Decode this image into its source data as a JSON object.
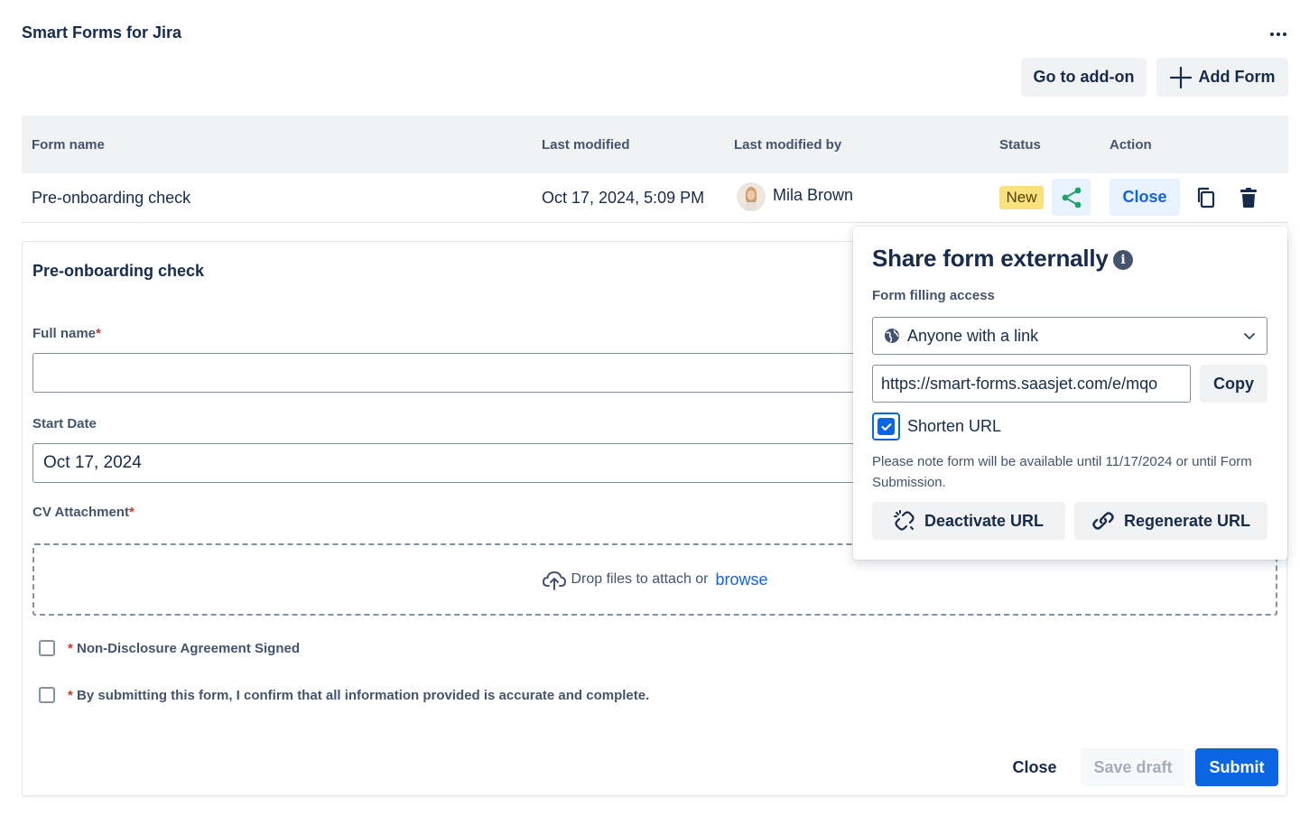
{
  "app": {
    "title": "Smart Forms for Jira",
    "more_icon": "more-horizontal-icon"
  },
  "toolbar": {
    "goto_label": "Go to add-on",
    "add_form_label": "Add Form",
    "add_icon": "plus-icon"
  },
  "table": {
    "headers": [
      "Form name",
      "Last modified",
      "Last modified by",
      "Status",
      "Action"
    ],
    "rows": [
      {
        "name": "Pre-onboarding check",
        "modified": "Oct 17, 2024, 5:09 PM",
        "modified_by": "Mila Brown",
        "status": "New",
        "close_label": "Close"
      }
    ]
  },
  "form": {
    "title": "Pre-onboarding check",
    "fields": {
      "full_name_label": "Full name",
      "full_name_value": "",
      "start_date_label": "Start Date",
      "start_date_value": "Oct 17, 2024",
      "cv_label": "CV Attachment",
      "required_mark": "*"
    },
    "dropzone": {
      "text": "Drop files to attach or",
      "link": "browse"
    },
    "checkboxes": [
      {
        "label": "Non-Disclosure Agreement Signed",
        "checked": false
      },
      {
        "label": "By submitting this form, I confirm that all information provided is accurate and complete.",
        "checked": false
      }
    ],
    "buttons": {
      "close": "Close",
      "save_draft": "Save draft",
      "submit": "Submit"
    }
  },
  "share_popup": {
    "title": "Share form externally",
    "info_glyph": "i",
    "access_label": "Form filling access",
    "access_value": "Anyone with a link",
    "url_value": "https://smart-forms.saasjet.com/e/mqo",
    "copy_label": "Copy",
    "shorten_label": "Shorten URL",
    "shorten_checked": true,
    "note": "Please note form will be available until 11/17/2024 or until Form Submission.",
    "deactivate_label": "Deactivate URL",
    "regenerate_label": "Regenerate URL"
  },
  "colors": {
    "primary": "#0c66e4",
    "share_green": "#22a06b",
    "badge_yellow": "#f8e27d",
    "text": "#172b4d",
    "subtle_text": "#44546f",
    "required": "#c9372c"
  }
}
